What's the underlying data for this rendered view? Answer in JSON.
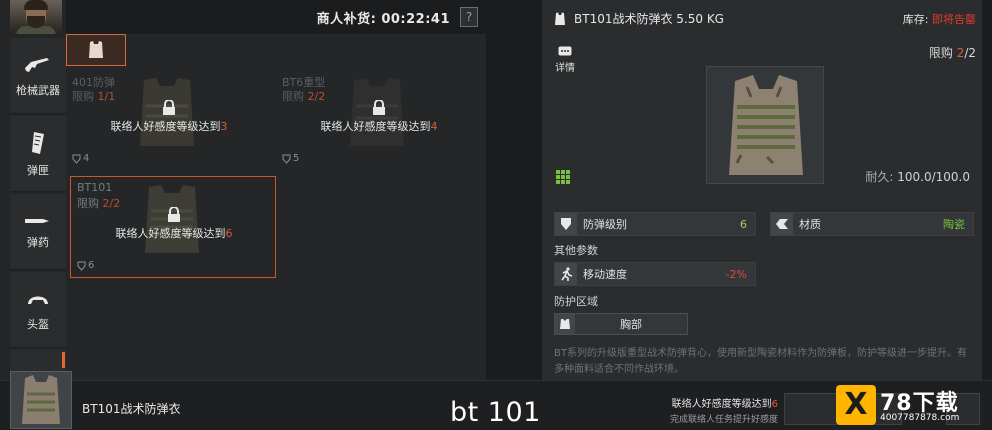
{
  "sidebar": {
    "items": [
      {
        "label": "枪械武器",
        "icon": "rifle-icon"
      },
      {
        "label": "弹匣",
        "icon": "magazine-icon"
      },
      {
        "label": "弹药",
        "icon": "bullet-icon"
      },
      {
        "label": "头盔",
        "icon": "helmet-icon"
      }
    ]
  },
  "merchant": {
    "restock_label": "商人补货: 00:22:41",
    "help": "?"
  },
  "cards": [
    {
      "name": "401防弹",
      "limit_label": "限购",
      "limit_value": "1/1",
      "req_text": "联络人好感度等级达到",
      "req_level": "3",
      "armor_level": "4"
    },
    {
      "name": "BT6重型",
      "limit_label": "限购",
      "limit_value": "2/2",
      "req_text": "联络人好感度等级达到",
      "req_level": "4",
      "armor_level": "5"
    },
    {
      "name": "BT101",
      "limit_label": "限购",
      "limit_value": "2/2",
      "req_text": "联络人好感度等级达到",
      "req_level": "6",
      "armor_level": "6"
    }
  ],
  "detail": {
    "title": "BT101战术防弹衣 5.50 KG",
    "stock_label": "库存: ",
    "stock_value": "即将告罄",
    "details_btn": "详情",
    "limit_label": "限购 ",
    "limit_value": "2",
    "limit_total": "/2",
    "durability_label": "耐久: ",
    "durability_value": "100.0/100.0",
    "armor_class_label": "防弹级别",
    "armor_class_value": "6",
    "material_label": "材质",
    "material_value": "陶瓷",
    "other_params_label": "其他参数",
    "move_speed_label": "移动速度",
    "move_speed_value": "-2%",
    "protection_area_label": "防护区域",
    "protection_area_value": "胸部",
    "description": "BT系列的升级版重型战术防弹背心，使用新型陶瓷材料作为防弹板，防护等级进一步提升。有多种面料适合不同作战环境。"
  },
  "bottom": {
    "item_name": "BT101战术防弹衣",
    "caption": "bt 101",
    "req_text": "联络人好感度等级达到",
    "req_level": "6",
    "req_sub": "完成联络人任务提升好感度"
  },
  "watermark": {
    "x": "X",
    "brand": "78下载",
    "url": "4007787878.com"
  },
  "colors": {
    "accent_orange": "#e0583a",
    "warning_red": "#e03a2f",
    "positive_yellow": "#c8c050",
    "material_green": "#7ac040",
    "speed_red": "#e04a3a"
  }
}
